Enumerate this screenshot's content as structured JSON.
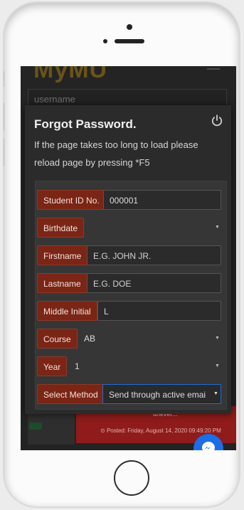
{
  "app": {
    "brand": "MyMU"
  },
  "background": {
    "username_placeholder": "username",
    "post_excerpt": "unever...",
    "posted_text": "Posted: Friday, August 14, 2020 09:49:20 PM"
  },
  "modal": {
    "title": "Forgot Password.",
    "message": "If the page takes too long to load please reload page by pressing *F5"
  },
  "form": {
    "student_id": {
      "label": "Student ID No.",
      "value": "000001"
    },
    "birthdate": {
      "label": "Birthdate",
      "value": ""
    },
    "firstname": {
      "label": "Firstname",
      "placeholder": "E.G. JOHN JR."
    },
    "lastname": {
      "label": "Lastname",
      "placeholder": "E.G. DOE"
    },
    "middle_initial": {
      "label": "Middle Initial",
      "value": "L"
    },
    "course": {
      "label": "Course",
      "value": "AB"
    },
    "year": {
      "label": "Year",
      "value": "1"
    },
    "method": {
      "label": "Select Method",
      "value": "Send through active emai"
    }
  },
  "colors": {
    "label_bg": "#7a2515",
    "accent_border": "#1f6ed4",
    "messenger": "#1e6de8"
  },
  "icons": {
    "power": "power-icon",
    "caret": "caret-down-icon",
    "clock": "clock-icon",
    "messenger": "messenger-icon"
  }
}
